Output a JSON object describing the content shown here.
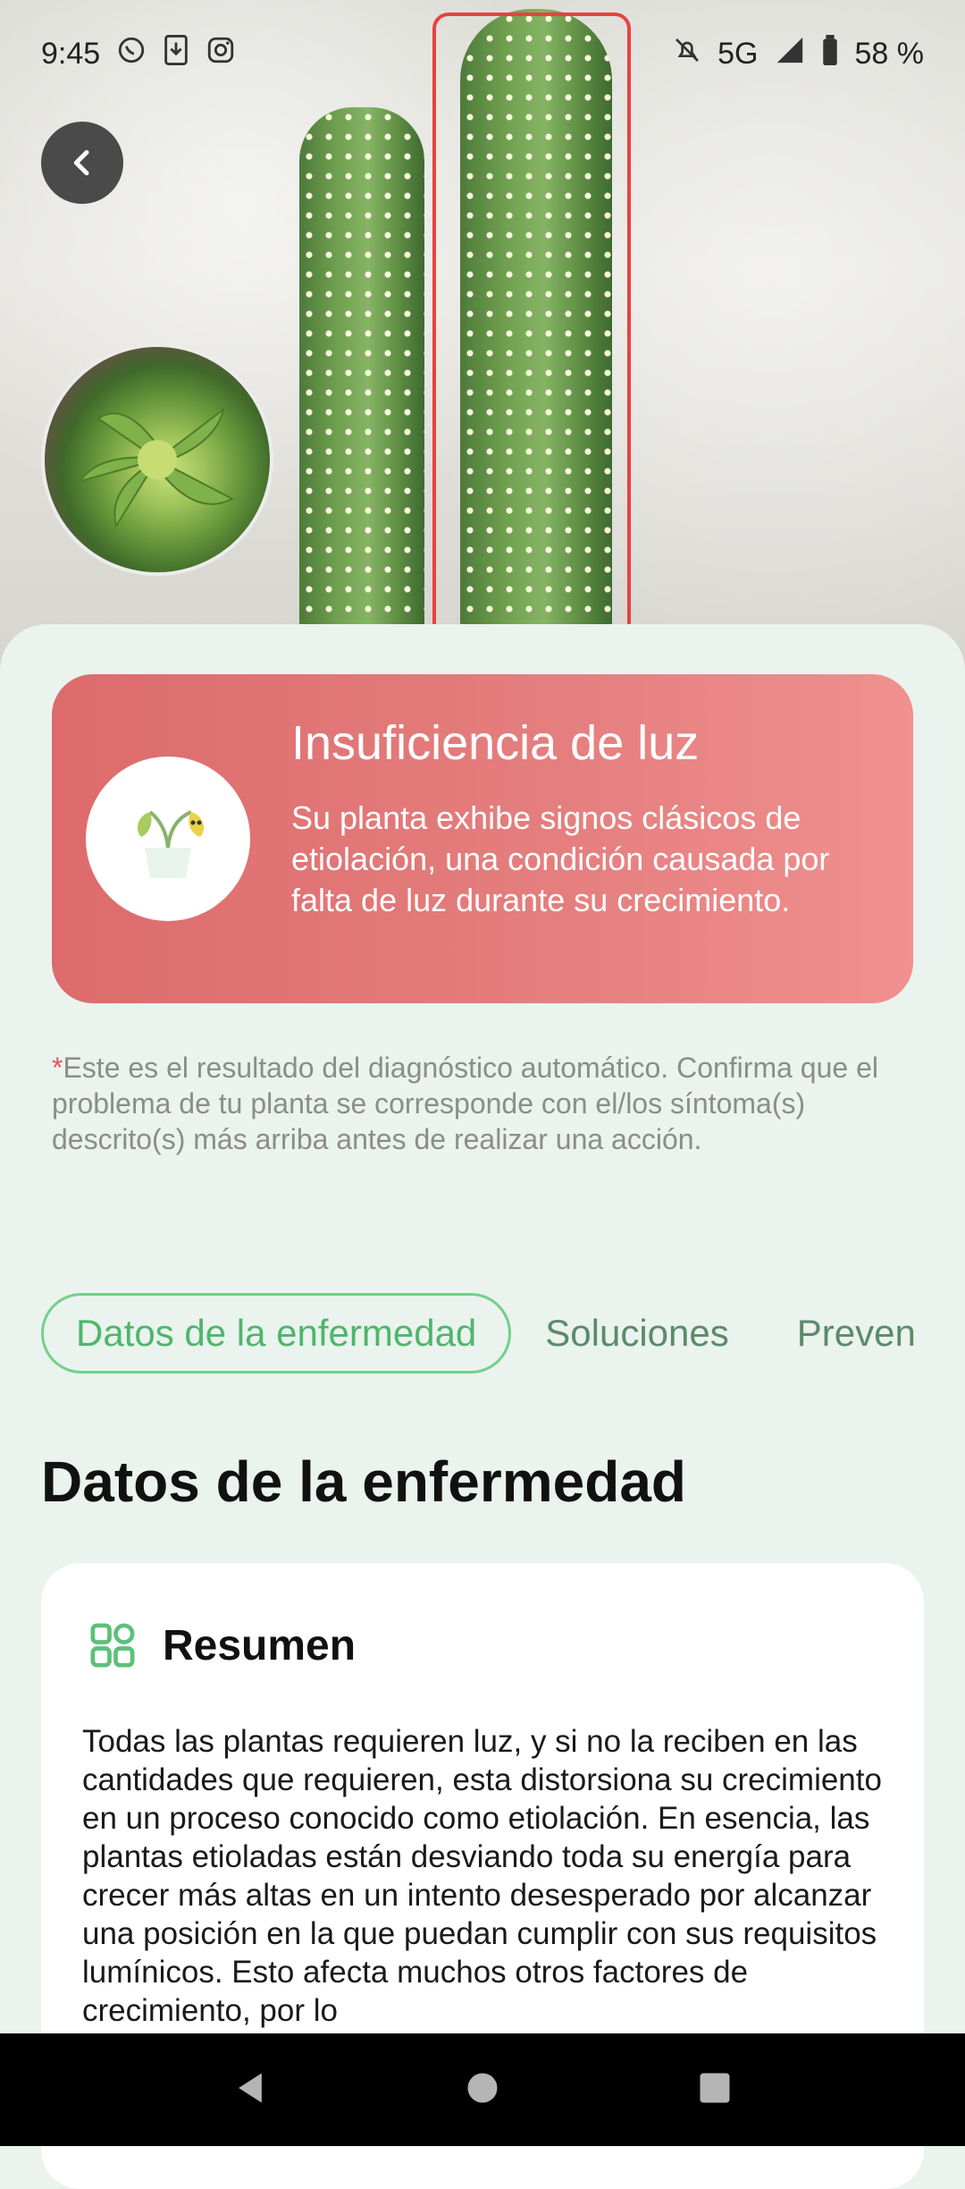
{
  "status_bar": {
    "time": "9:45",
    "network": "5G",
    "battery": "58 %",
    "left_icons": [
      "whatsapp-icon",
      "download-icon",
      "instagram-icon"
    ],
    "right_icons": [
      "bell-off-icon",
      "signal-icon",
      "battery-icon"
    ]
  },
  "diagnosis": {
    "title": "Insuficiencia de luz",
    "description": "Su planta exhibe signos clásicos de etiolación, una condición causada por falta de luz durante su crecimiento.",
    "accent_color": "#e07070"
  },
  "disclaimer": {
    "asterisk": "*",
    "text": "Este es el resultado del diagnóstico automático. Confirma que el problema de tu planta se corresponde con el/los síntoma(s) descrito(s) más arriba antes de realizar una acción."
  },
  "tabs": [
    {
      "label": "Datos de la enfermedad",
      "active": true
    },
    {
      "label": "Soluciones",
      "active": false
    },
    {
      "label": "Preven",
      "active": false
    }
  ],
  "section": {
    "title": "Datos de la enfermedad"
  },
  "summary": {
    "title": "Resumen",
    "icon": "grid-icon",
    "text": "Todas las plantas requieren luz, y si no la reciben en las cantidades que requieren, esta distorsiona su crecimiento en un proceso conocido como etiolación. En esencia, las plantas etioladas están desviando toda su energía para crecer más altas en un intento desesperado por alcanzar una posición en la que puedan cumplir con sus requisitos lumínicos. Esto afecta muchos otros factores de crecimiento, por lo"
  },
  "colors": {
    "brand_green": "#4fb56b",
    "sheet_bg": "#eaf3ee",
    "detection_box": "#e8423f"
  }
}
